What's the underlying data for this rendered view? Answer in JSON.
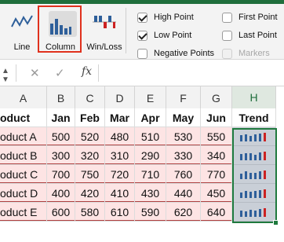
{
  "ribbon": {
    "types": [
      {
        "label": "Line",
        "icon": "line-sparkline-icon"
      },
      {
        "label": "Column",
        "icon": "column-sparkline-icon",
        "selected": true
      },
      {
        "label": "Win/Loss",
        "icon": "win-loss-sparkline-icon"
      }
    ],
    "show": [
      {
        "label": "High Point",
        "checked": true,
        "enabled": true
      },
      {
        "label": "Low Point",
        "checked": true,
        "enabled": true
      },
      {
        "label": "Negative Points",
        "checked": false,
        "enabled": true
      },
      {
        "label": "First Point",
        "checked": false,
        "enabled": true
      },
      {
        "label": "Last Point",
        "checked": false,
        "enabled": true
      },
      {
        "label": "Markers",
        "checked": false,
        "enabled": false
      }
    ]
  },
  "formula_bar": {
    "check": "✓",
    "cancel": "✕",
    "fx": "fx",
    "value": ""
  },
  "sheet": {
    "col_headers": [
      "A",
      "B",
      "C",
      "D",
      "E",
      "F",
      "G",
      "H"
    ],
    "headers": [
      "oduct",
      "Jan",
      "Feb",
      "Mar",
      "Apr",
      "May",
      "Jun",
      "Trend"
    ],
    "rows": [
      {
        "product": "oduct A",
        "values": [
          "500",
          "520",
          "480",
          "510",
          "530",
          "550"
        ],
        "data": [
          500,
          520,
          480,
          510,
          530,
          550
        ]
      },
      {
        "product": "oduct B",
        "values": [
          "300",
          "320",
          "310",
          "290",
          "330",
          "340"
        ],
        "data": [
          300,
          320,
          310,
          290,
          330,
          340
        ]
      },
      {
        "product": "oduct C",
        "values": [
          "700",
          "750",
          "720",
          "710",
          "760",
          "770"
        ],
        "data": [
          700,
          750,
          720,
          710,
          760,
          770
        ]
      },
      {
        "product": "oduct D",
        "values": [
          "400",
          "420",
          "410",
          "430",
          "440",
          "450"
        ],
        "data": [
          400,
          420,
          410,
          430,
          440,
          450
        ]
      },
      {
        "product": "oduct E",
        "values": [
          "600",
          "580",
          "610",
          "590",
          "620",
          "640"
        ],
        "data": [
          600,
          580,
          610,
          590,
          620,
          640
        ]
      }
    ]
  },
  "colors": {
    "accent": "#1f6e3c",
    "highlight": "#e0311d",
    "sparkline": "#2e5f9a",
    "high_point": "#cc2222",
    "row_fill": "#fde4e4"
  }
}
